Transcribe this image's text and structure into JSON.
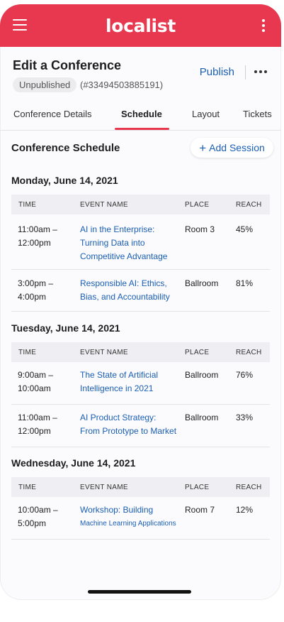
{
  "header": {
    "brand": "localist",
    "color": "#e8384f"
  },
  "conference": {
    "page_title": "Edit a Conference",
    "status": "Unpublished",
    "id": "(#33494503885191)",
    "publish_label": "Publish"
  },
  "tabs": [
    {
      "label": "Conference Details"
    },
    {
      "label": "Schedule"
    },
    {
      "label": "Layout"
    },
    {
      "label": "Tickets"
    }
  ],
  "schedule": {
    "title": "Conference Schedule",
    "add_label": "Add Session",
    "add_icon": "+",
    "columns": [
      "TIME",
      "EVENT NAME",
      "PLACE",
      "REACH"
    ],
    "days": [
      {
        "date": "Monday, June 14, 2021",
        "sessions": [
          {
            "time1": "11:00am –",
            "time2": "12:00pm",
            "name1": "AI in the Enterprise:",
            "name2": "Turning Data into",
            "name3": "Competitive Advantage",
            "place": "Room 3",
            "reach": "45%"
          },
          {
            "time1": "3:00pm –",
            "time2": "4:00pm",
            "name1": "Responsible AI: Ethics,",
            "name2": "Bias, and Accountability",
            "place": "Ballroom",
            "reach": "81%"
          }
        ]
      },
      {
        "date": "Tuesday, June 14, 2021",
        "sessions": [
          {
            "time1": "9:00am –",
            "time2": "10:00am",
            "name1": "The State of Artificial",
            "name2": "Intelligence in 2021",
            "place": "Ballroom",
            "reach": "76%"
          },
          {
            "time1": "11:00am –",
            "time2": "12:00pm",
            "name1": "AI Product Strategy:",
            "name2": "From Prototype to Market",
            "place": "Ballroom",
            "reach": "33%"
          }
        ]
      },
      {
        "date": "Wednesday, June 14, 2021",
        "sessions": [
          {
            "time1": "10:00am –",
            "time2": "5:00pm",
            "name1": "Workshop: Building",
            "name2": "Machine Learning Applications",
            "place": "Room 7",
            "reach": "12%"
          }
        ]
      }
    ]
  }
}
